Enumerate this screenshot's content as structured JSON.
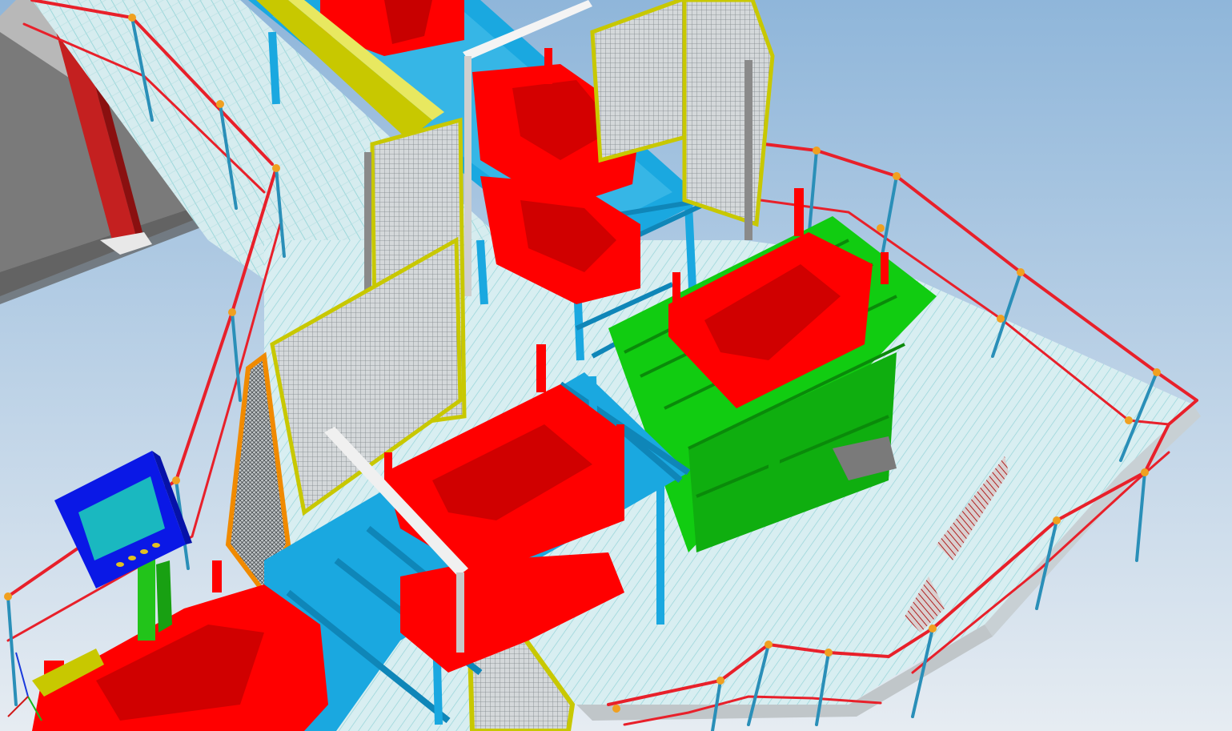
{
  "viewer": {
    "kind": "3D CAD plant layout viewport",
    "visible_text": []
  },
  "colors": {
    "sky_top": "#8fb6da",
    "sky_bottom": "#dfe7ef",
    "grating": "#cfe6ea",
    "grating_line": "#8fd3d6",
    "fixture_red": "#ff0000",
    "fixture_green": "#11cc11",
    "conveyor_blue": "#1aa8e0",
    "railing_red": "#e8202a",
    "railing_post": "#2a8fb8",
    "fence_yellow": "#c8c800",
    "fence_mesh": "#9aa0a4",
    "panel_blue": "#0a18e6",
    "panel_screen": "#1ab8c0",
    "panel_stand": "#22c41a",
    "wall_gray": "#7a7a7a",
    "column_red": "#c42020",
    "door_orange": "#f08a00"
  },
  "objects": {
    "fixtures_red": 6,
    "fixtures_green": 1,
    "operator_panels": 1,
    "safety_fences": 4
  },
  "icons": {
    "axis_triad": "axis-triad-icon"
  }
}
